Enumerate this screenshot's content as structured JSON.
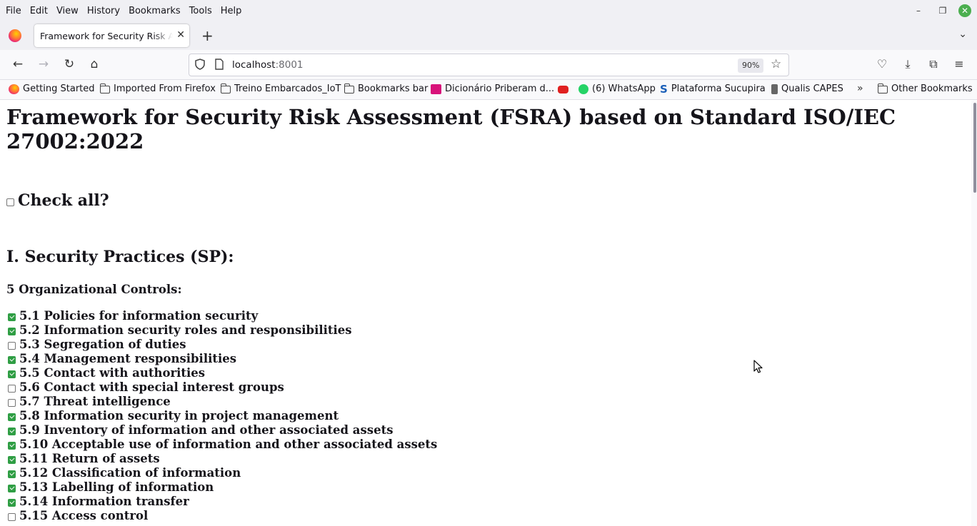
{
  "menubar": {
    "items": [
      "File",
      "Edit",
      "View",
      "History",
      "Bookmarks",
      "Tools",
      "Help"
    ]
  },
  "window_controls": {
    "minimize": "–",
    "restore": "❐",
    "close": "✕"
  },
  "tabstrip": {
    "tab_title": "Framework for Security Risk Assessment",
    "close_glyph": "✕",
    "new_tab_glyph": "+",
    "list_all_tabs_glyph": "⌄"
  },
  "navbar": {
    "back": "←",
    "forward": "→",
    "reload": "↻",
    "home": "⌂",
    "url_host": "localhost",
    "url_port": ":8001",
    "zoom": "90%",
    "bookmark_star": "☆",
    "pocket": "♡",
    "downloads": "⤓",
    "extensions": "⧉",
    "menu": "≡"
  },
  "bookmarks": [
    {
      "label": "Getting Started",
      "icon": "firefox-icon"
    },
    {
      "label": "Imported From Firefox",
      "icon": "folder-icon"
    },
    {
      "label": "Treino Embarcados_IoT",
      "icon": "folder-icon"
    },
    {
      "label": "Bookmarks bar",
      "icon": "folder-icon"
    },
    {
      "label": "Dicionário Priberam d...",
      "icon": "priberam-icon"
    },
    {
      "label": "",
      "icon": "youtube-icon"
    },
    {
      "label": "(6) WhatsApp",
      "icon": "whatsapp-icon"
    },
    {
      "label": "Plataforma Sucupira",
      "icon": "sucupira-icon"
    },
    {
      "label": "Qualis CAPES",
      "icon": "capes-icon"
    }
  ],
  "bookmarks_overflow": "»",
  "other_bookmarks": "Other Bookmarks",
  "page": {
    "title": "Framework for Security Risk Assessment (FSRA) based on Standard ISO/IEC 27002:2022",
    "check_all_label": "Check all?",
    "check_all_checked": false,
    "section_title": "I. Security Practices (SP):",
    "group_title": "5 Organizational Controls:",
    "controls": [
      {
        "label": "5.1 Policies for information security",
        "checked": true
      },
      {
        "label": "5.2 Information security roles and responsibilities",
        "checked": true
      },
      {
        "label": "5.3 Segregation of duties",
        "checked": false
      },
      {
        "label": "5.4 Management responsibilities",
        "checked": true
      },
      {
        "label": "5.5 Contact with authorities",
        "checked": true
      },
      {
        "label": "5.6 Contact with special interest groups",
        "checked": false
      },
      {
        "label": "5.7 Threat intelligence",
        "checked": false
      },
      {
        "label": "5.8 Information security in project management",
        "checked": true
      },
      {
        "label": "5.9 Inventory of information and other associated assets",
        "checked": true
      },
      {
        "label": "5.10 Acceptable use of information and other associated assets",
        "checked": true
      },
      {
        "label": "5.11 Return of assets",
        "checked": true
      },
      {
        "label": "5.12 Classification of information",
        "checked": true
      },
      {
        "label": "5.13 Labelling of information",
        "checked": true
      },
      {
        "label": "5.14 Information transfer",
        "checked": true
      },
      {
        "label": "5.15 Access control",
        "checked": false
      }
    ]
  }
}
